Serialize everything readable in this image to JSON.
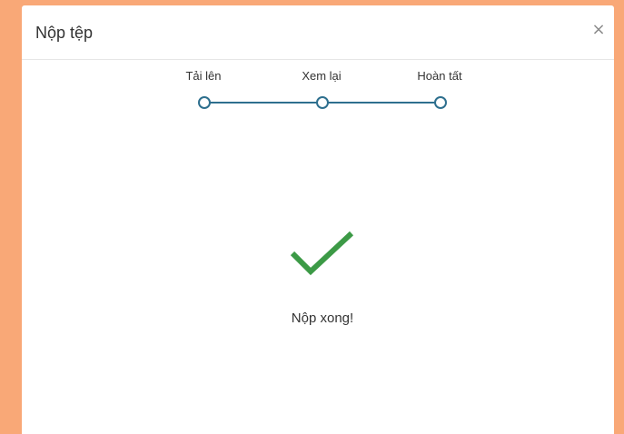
{
  "dialog": {
    "title": "Nộp tệp",
    "close_label": "×"
  },
  "stepper": {
    "steps": [
      {
        "label": "Tải lên"
      },
      {
        "label": "Xem lại"
      },
      {
        "label": "Hoàn tất"
      }
    ],
    "active_color": "#2e6f8e"
  },
  "result": {
    "icon": "checkmark-icon",
    "icon_color": "#3c9a46",
    "message": "Nộp xong!"
  },
  "colors": {
    "page_background": "#f9a877",
    "dialog_background": "#ffffff"
  }
}
